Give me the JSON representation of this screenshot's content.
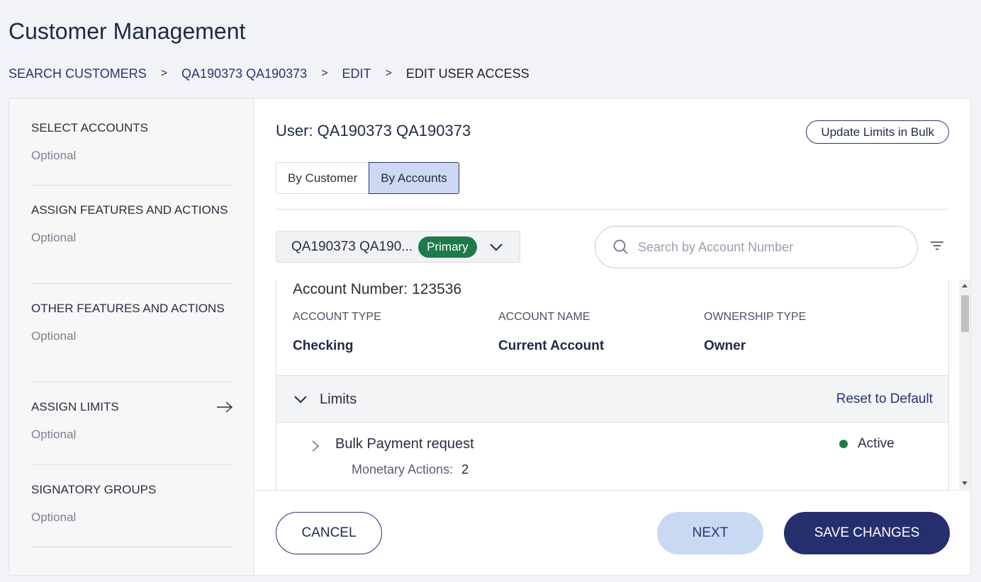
{
  "page": {
    "title": "Customer Management"
  },
  "breadcrumb": {
    "items": [
      "SEARCH CUSTOMERS",
      "QA190373 QA190373",
      "EDIT"
    ],
    "current": "EDIT USER ACCESS",
    "separator": ">"
  },
  "sidebar": {
    "steps": [
      {
        "title": "SELECT ACCOUNTS",
        "sub": "Optional"
      },
      {
        "title": "ASSIGN FEATURES AND ACTIONS",
        "sub": "Optional"
      },
      {
        "title": "OTHER FEATURES AND ACTIONS",
        "sub": "Optional"
      },
      {
        "title": "ASSIGN LIMITS",
        "sub": "Optional",
        "active": true
      },
      {
        "title": "SIGNATORY GROUPS",
        "sub": "Optional"
      }
    ]
  },
  "main": {
    "user_title": "User: QA190373 QA190373",
    "bulk_button": "Update Limits in Bulk",
    "tabs": [
      {
        "label": "By Customer",
        "active": false
      },
      {
        "label": "By Accounts",
        "active": true
      }
    ],
    "account_select": {
      "value": "QA190373 QA190...",
      "badge": "Primary"
    },
    "search": {
      "placeholder": "Search by Account Number"
    },
    "account": {
      "number_label": "Account Number: 123536",
      "columns": [
        {
          "header": "ACCOUNT TYPE",
          "value": "Checking"
        },
        {
          "header": "ACCOUNT NAME",
          "value": "Current Account"
        },
        {
          "header": "OWNERSHIP TYPE",
          "value": "Owner"
        }
      ]
    },
    "limits": {
      "label": "Limits",
      "reset": "Reset to Default",
      "rows": [
        {
          "name": "Bulk Payment request",
          "sub_label": "Monetary Actions:",
          "count": "2",
          "status": "Active"
        }
      ]
    }
  },
  "footer": {
    "cancel": "CANCEL",
    "next": "NEXT",
    "save": "SAVE CHANGES"
  },
  "colors": {
    "primary": "#262f6e",
    "success": "#1d7a4a",
    "next_bg": "#c9d9f3",
    "tab_active": "#cdd9f3"
  }
}
